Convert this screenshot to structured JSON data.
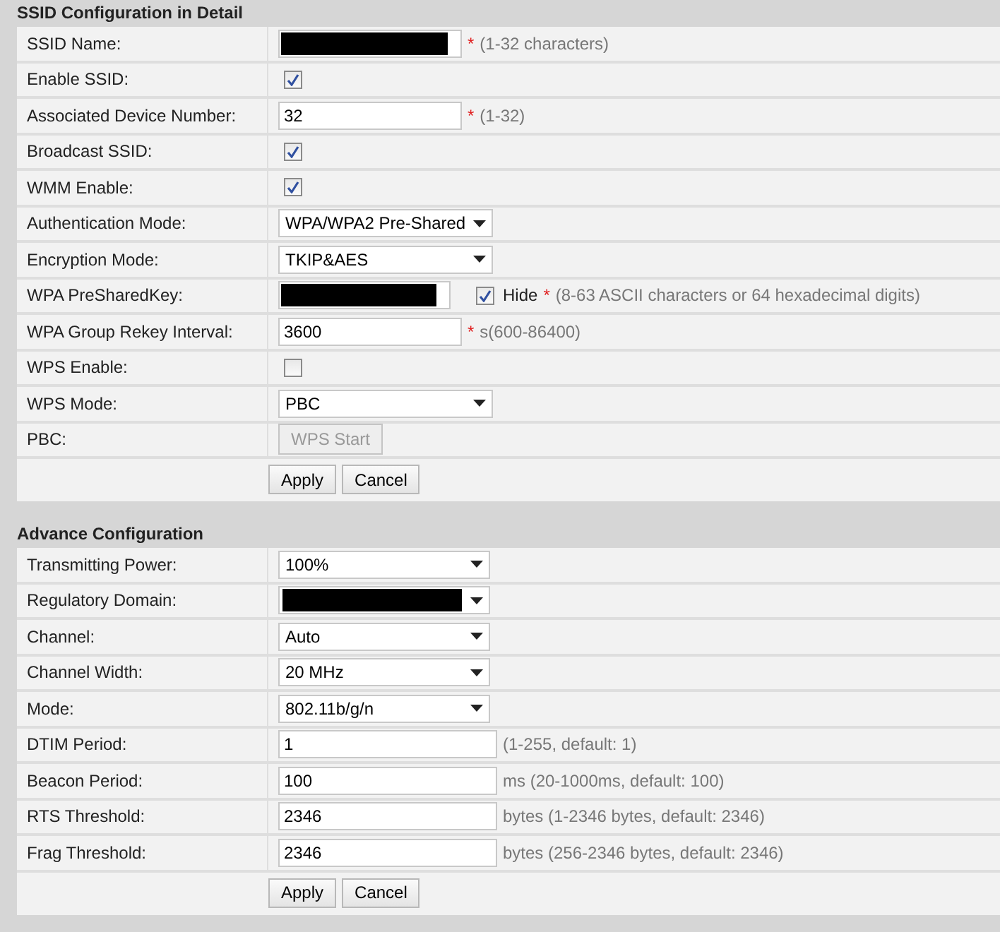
{
  "sections": [
    {
      "title": "SSID Configuration in Detail",
      "rows": [
        {
          "kind": "text",
          "label": "SSID Name:",
          "value": "",
          "redacted": true,
          "required_mark": "*",
          "hint": "(1-32 characters)"
        },
        {
          "kind": "checkbox",
          "label": "Enable SSID:",
          "checked": true
        },
        {
          "kind": "text",
          "label": "Associated Device Number:",
          "value": "32",
          "redacted": false,
          "required_mark": "*",
          "hint": "(1-32)"
        },
        {
          "kind": "checkbox",
          "label": "Broadcast SSID:",
          "checked": true
        },
        {
          "kind": "checkbox",
          "label": "WMM Enable:",
          "checked": true
        },
        {
          "kind": "select",
          "label": "Authentication Mode:",
          "value": "WPA/WPA2 Pre-Shared",
          "redacted": false
        },
        {
          "kind": "select",
          "label": "Encryption Mode:",
          "value": "TKIP&AES",
          "redacted": false
        },
        {
          "kind": "password",
          "label": "WPA PreSharedKey:",
          "redacted": true,
          "hide_label": "Hide",
          "hide_checked": true,
          "required_mark": "*",
          "hint": "(8-63 ASCII characters or 64 hexadecimal digits)"
        },
        {
          "kind": "text",
          "label": "WPA Group Rekey Interval:",
          "value": "3600",
          "redacted": false,
          "required_mark": "*",
          "hint": "s(600-86400)"
        },
        {
          "kind": "checkbox",
          "label": "WPS Enable:",
          "checked": false
        },
        {
          "kind": "select",
          "label": "WPS Mode:",
          "value": "PBC",
          "redacted": false
        },
        {
          "kind": "button",
          "label": "PBC:",
          "button": "WPS Start",
          "disabled": true
        }
      ],
      "buttons": [
        "Apply",
        "Cancel"
      ]
    },
    {
      "title": "Advance Configuration",
      "rows": [
        {
          "kind": "select",
          "label": "Transmitting Power:",
          "value": "100%",
          "redacted": false
        },
        {
          "kind": "select",
          "label": "Regulatory Domain:",
          "value": "",
          "redacted": true
        },
        {
          "kind": "select",
          "label": "Channel:",
          "value": "Auto",
          "redacted": false
        },
        {
          "kind": "select",
          "label": "Channel Width:",
          "value": "20 MHz",
          "redacted": false
        },
        {
          "kind": "select",
          "label": "Mode:",
          "value": "802.11b/g/n",
          "redacted": false
        },
        {
          "kind": "text",
          "label": "DTIM Period:",
          "value": "1",
          "redacted": false,
          "hint": "(1-255, default: 1)"
        },
        {
          "kind": "text",
          "label": "Beacon Period:",
          "value": "100",
          "redacted": false,
          "hint": "ms (20-1000ms, default: 100)"
        },
        {
          "kind": "text",
          "label": "RTS Threshold:",
          "value": "2346",
          "redacted": false,
          "hint": "bytes (1-2346 bytes, default: 2346)"
        },
        {
          "kind": "text",
          "label": "Frag Threshold:",
          "value": "2346",
          "redacted": false,
          "hint": "bytes (256-2346 bytes, default: 2346)"
        }
      ],
      "buttons": [
        "Apply",
        "Cancel"
      ]
    }
  ]
}
